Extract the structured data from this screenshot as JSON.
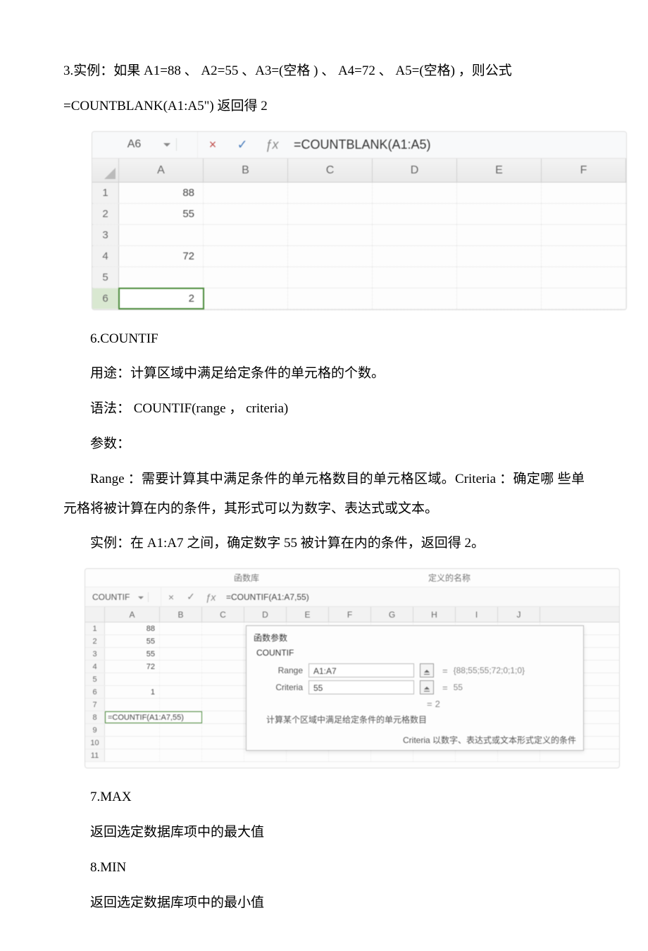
{
  "text": {
    "p1a": "3.实例：如果 A1=88 、 A2=55 、A3=(空格 ) 、 A4=72 、 A5=(空格) ，则公式",
    "p1b": "=COUNTBLANK(A1:A5\") 返回得 2",
    "p2": "6.COUNTIF",
    "p3": "用途：计算区域中满足给定条件的单元格的个数。",
    "p4": "语法： COUNTIF(range ， criteria)",
    "p5": "参数：",
    "p6": "Range ：需要计算其中满足条件的单元格数目的单元格区域。Criteria ：确定哪 些单元格将被计算在内的条件，其形式可以为数字、表达式或文本。",
    "p7": "实例：在 A1:A7 之间，确定数字 55 被计算在内的条件，返回得 2。",
    "p8": "7.MAX",
    "p9": "返回选定数据库项中的最大值",
    "p10": "8.MIN",
    "p11": "返回选定数据库项中的最小值"
  },
  "fig1": {
    "name_box": "A6",
    "formula": "=COUNTBLANK(A1:A5)",
    "columns": [
      "A",
      "B",
      "C",
      "D",
      "E",
      "F"
    ],
    "rows": [
      {
        "n": "1",
        "A": "88"
      },
      {
        "n": "2",
        "A": "55"
      },
      {
        "n": "3",
        "A": ""
      },
      {
        "n": "4",
        "A": "72"
      },
      {
        "n": "5",
        "A": ""
      },
      {
        "n": "6",
        "A": "2"
      }
    ],
    "selected_row": "6"
  },
  "fig2": {
    "tab_left": "函数库",
    "tab_right": "定义的名称",
    "name_box": "COUNTIF",
    "formula": "=COUNTIF(A1:A7,55)",
    "columns": [
      "A",
      "B",
      "C",
      "D",
      "E",
      "F",
      "G",
      "H",
      "I",
      "J"
    ],
    "rows": [
      {
        "n": "1",
        "A": "88"
      },
      {
        "n": "2",
        "A": "55"
      },
      {
        "n": "3",
        "A": "55"
      },
      {
        "n": "4",
        "A": "72"
      },
      {
        "n": "5",
        "A": ""
      },
      {
        "n": "6",
        "A": "1"
      },
      {
        "n": "7",
        "A": ""
      },
      {
        "n": "8",
        "A": "=COUNTIF(A1:A7,55)"
      },
      {
        "n": "9",
        "A": ""
      },
      {
        "n": "10",
        "A": ""
      },
      {
        "n": "11",
        "A": ""
      }
    ],
    "dialog": {
      "title": "函数参数",
      "name": "COUNTIF",
      "range_label": "Range",
      "range_value": "A1:A7",
      "range_eval": "{88;55;55;72;0;1;0}",
      "criteria_label": "Criteria",
      "criteria_value": "55",
      "criteria_eval": "55",
      "result_eq": "=",
      "result_val": "2",
      "desc": "计算某个区域中满足给定条件的单元格数目",
      "foot": "Criteria  以数字、表达式或文本形式定义的条件"
    }
  }
}
